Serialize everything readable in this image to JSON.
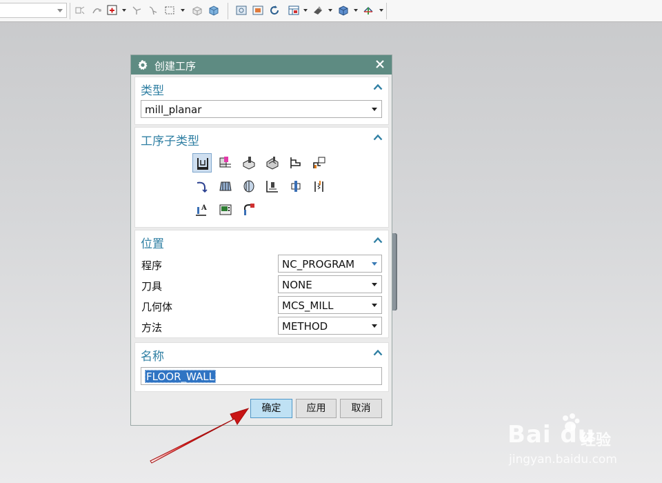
{
  "colors": {
    "titlebar": "#5e8b82",
    "group_title": "#2f7fa3",
    "selection": "#2f74c3",
    "primary_button": "#bfe1f4",
    "arrow": "#e01e1e"
  },
  "toolbar": {
    "combo_value": "",
    "icons": [
      "move-icon",
      "bend-icon",
      "add-point-icon",
      "snap-icon",
      "drag-icon",
      "select-box-icon",
      "cube-outline-icon",
      "cube-solid-icon",
      "fit-view-icon",
      "image-icon",
      "refresh-icon",
      "layout-icon",
      "shade-icon",
      "cube-view-icon",
      "orient-icon"
    ]
  },
  "dialog": {
    "title": "创建工序",
    "icon": "gear-icon",
    "close_icon": "close-icon",
    "type_group": {
      "title": "类型",
      "value": "mill_planar"
    },
    "subtype_group": {
      "title": "工序子类型",
      "icons": [
        "floor-wall-icon",
        "floor-wall-ipw-icon",
        "face-milling-icon",
        "face-milling-area-icon",
        "planar-mill-icon",
        "planar-profile-icon",
        "clean-corner-icon",
        "finish-walls-icon",
        "finish-floor-icon",
        "groove-milling-icon",
        "hole-milling-icon",
        "thread-milling-icon",
        "planar-text-icon",
        "mill-control-icon",
        "mill-user-icon"
      ],
      "selected": "floor-wall-icon"
    },
    "location_group": {
      "title": "位置",
      "rows": [
        {
          "label": "程序",
          "value": "NC_PROGRAM"
        },
        {
          "label": "刀具",
          "value": "NONE"
        },
        {
          "label": "几何体",
          "value": "MCS_MILL"
        },
        {
          "label": "方法",
          "value": "METHOD"
        }
      ]
    },
    "name_group": {
      "title": "名称",
      "value": "FLOOR_WALL"
    },
    "buttons": {
      "ok": "确定",
      "apply": "应用",
      "cancel": "取消"
    }
  },
  "watermark": {
    "brand": "Bai du",
    "sub": "经验",
    "url": "jingyan.baidu.com"
  }
}
